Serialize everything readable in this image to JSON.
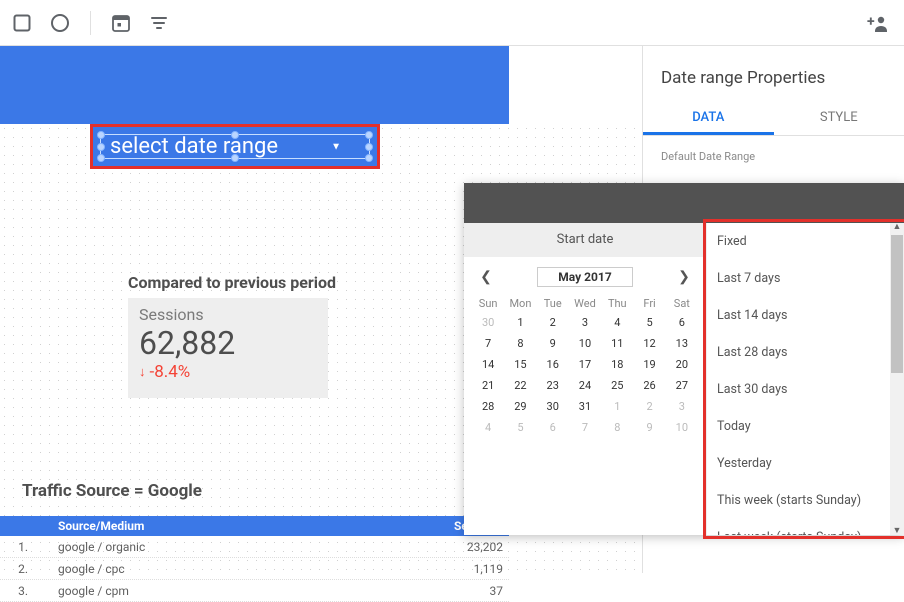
{
  "selector": {
    "label": "select date range"
  },
  "compare": {
    "title": "Compared to previous period"
  },
  "kpi": {
    "metric": "Sessions",
    "value": "62,882",
    "delta": "-8.4%"
  },
  "filter": {
    "label": "Traffic Source = Google"
  },
  "table": {
    "col_source": "Source/Medium",
    "col_sessions": "Sessions",
    "rows": [
      {
        "n": "1.",
        "source": "google / organic",
        "sessions": "23,202"
      },
      {
        "n": "2.",
        "source": "google / cpc",
        "sessions": "1,119"
      },
      {
        "n": "3.",
        "source": "google / cpm",
        "sessions": "37"
      }
    ]
  },
  "panel": {
    "title": "Date range Properties",
    "tab_data": "DATA",
    "tab_style": "STYLE",
    "section": "Default Date Range"
  },
  "calendar": {
    "start_tab": "Start date",
    "month": "May 2017",
    "dow": [
      "Sun",
      "Mon",
      "Tue",
      "Wed",
      "Thu",
      "Fri",
      "Sat"
    ],
    "weeks": [
      [
        {
          "d": "30",
          "dim": true
        },
        {
          "d": "1"
        },
        {
          "d": "2"
        },
        {
          "d": "3"
        },
        {
          "d": "4"
        },
        {
          "d": "5"
        },
        {
          "d": "6"
        }
      ],
      [
        {
          "d": "7"
        },
        {
          "d": "8"
        },
        {
          "d": "9"
        },
        {
          "d": "10"
        },
        {
          "d": "11"
        },
        {
          "d": "12"
        },
        {
          "d": "13"
        }
      ],
      [
        {
          "d": "14"
        },
        {
          "d": "15"
        },
        {
          "d": "16"
        },
        {
          "d": "17"
        },
        {
          "d": "18"
        },
        {
          "d": "19"
        },
        {
          "d": "20"
        }
      ],
      [
        {
          "d": "21"
        },
        {
          "d": "22"
        },
        {
          "d": "23"
        },
        {
          "d": "24"
        },
        {
          "d": "25"
        },
        {
          "d": "26"
        },
        {
          "d": "27"
        }
      ],
      [
        {
          "d": "28"
        },
        {
          "d": "29"
        },
        {
          "d": "30"
        },
        {
          "d": "31"
        },
        {
          "d": "1",
          "dim": true
        },
        {
          "d": "2",
          "dim": true
        },
        {
          "d": "3",
          "dim": true
        }
      ],
      [
        {
          "d": "4",
          "dim": true
        },
        {
          "d": "5",
          "dim": true
        },
        {
          "d": "6",
          "dim": true
        },
        {
          "d": "7",
          "dim": true
        },
        {
          "d": "8",
          "dim": true
        },
        {
          "d": "9",
          "dim": true
        },
        {
          "d": "10",
          "dim": true
        }
      ]
    ]
  },
  "dropdown": {
    "items": [
      "Fixed",
      "Last 7 days",
      "Last 14 days",
      "Last 28 days",
      "Last 30 days",
      "Today",
      "Yesterday",
      "This week (starts Sunday)",
      "Last week (starts Sunday)"
    ]
  }
}
